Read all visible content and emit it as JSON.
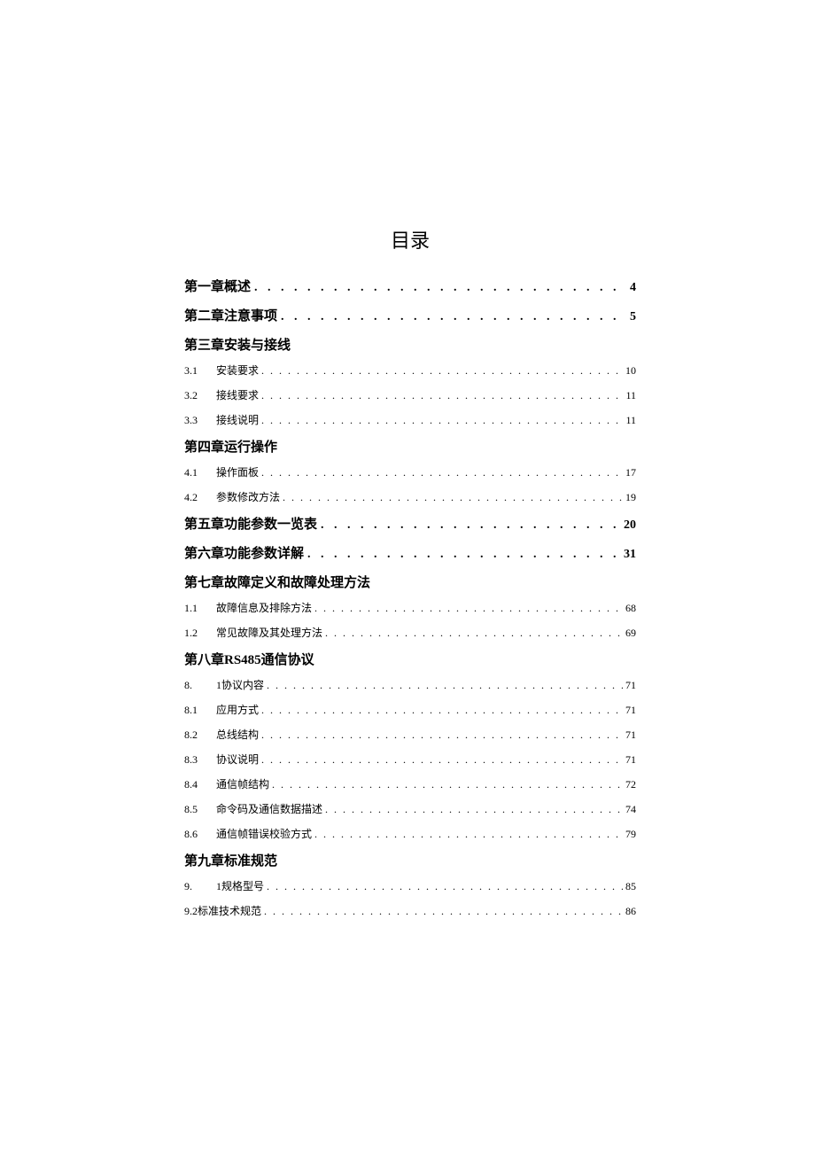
{
  "title": "目录",
  "entries": [
    {
      "type": "chapter",
      "label": "第一章概述",
      "page": "4"
    },
    {
      "type": "chapter",
      "label": "第二章注意事项",
      "page": "5"
    },
    {
      "type": "chapter-noline",
      "label": "第三章安装与接线"
    },
    {
      "type": "sub",
      "num": "3.1",
      "label": "安装要求",
      "page": "10"
    },
    {
      "type": "sub",
      "num": "3.2",
      "label": "接线要求",
      "page": "11"
    },
    {
      "type": "sub",
      "num": "3.3",
      "label": "接线说明",
      "page": "11"
    },
    {
      "type": "chapter-noline",
      "label": "第四章运行操作"
    },
    {
      "type": "sub",
      "num": "4.1",
      "label": "操作面板",
      "page": "17"
    },
    {
      "type": "sub",
      "num": "4.2",
      "label": "参数修改方法",
      "page": "19"
    },
    {
      "type": "chapter",
      "label": "第五章功能参数一览表",
      "page": "20"
    },
    {
      "type": "chapter",
      "label": "第六章功能参数详解",
      "page": "31"
    },
    {
      "type": "chapter-noline",
      "label": "第七章故障定义和故障处理方法"
    },
    {
      "type": "sub",
      "num": "1.1",
      "label": "故障信息及排除方法",
      "page": "68"
    },
    {
      "type": "sub",
      "num": "1.2",
      "label": "常见故障及其处理方法",
      "page": "69"
    },
    {
      "type": "chapter-noline",
      "label": "第八章RS485通信协议"
    },
    {
      "type": "sub",
      "num": "8.",
      "label": "1协议内容",
      "page": "71"
    },
    {
      "type": "sub",
      "num": "8.1",
      "label": "应用方式",
      "page": "71"
    },
    {
      "type": "sub",
      "num": "8.2",
      "label": "总线结构",
      "page": "71"
    },
    {
      "type": "sub",
      "num": "8.3",
      "label": "协议说明",
      "page": "71"
    },
    {
      "type": "sub",
      "num": "8.4",
      "label": "通信帧结构",
      "page": "72"
    },
    {
      "type": "sub",
      "num": "8.5",
      "label": "命令码及通信数据描述",
      "page": "74"
    },
    {
      "type": "sub",
      "num": "8.6",
      "label": "通信帧错误校验方式",
      "page": "79"
    },
    {
      "type": "chapter-noline",
      "label": "第九章标准规范"
    },
    {
      "type": "sub",
      "num": "9.",
      "label": "1规格型号",
      "page": "85"
    },
    {
      "type": "flat",
      "label": "9.2标准技术规范",
      "page": "86"
    }
  ]
}
